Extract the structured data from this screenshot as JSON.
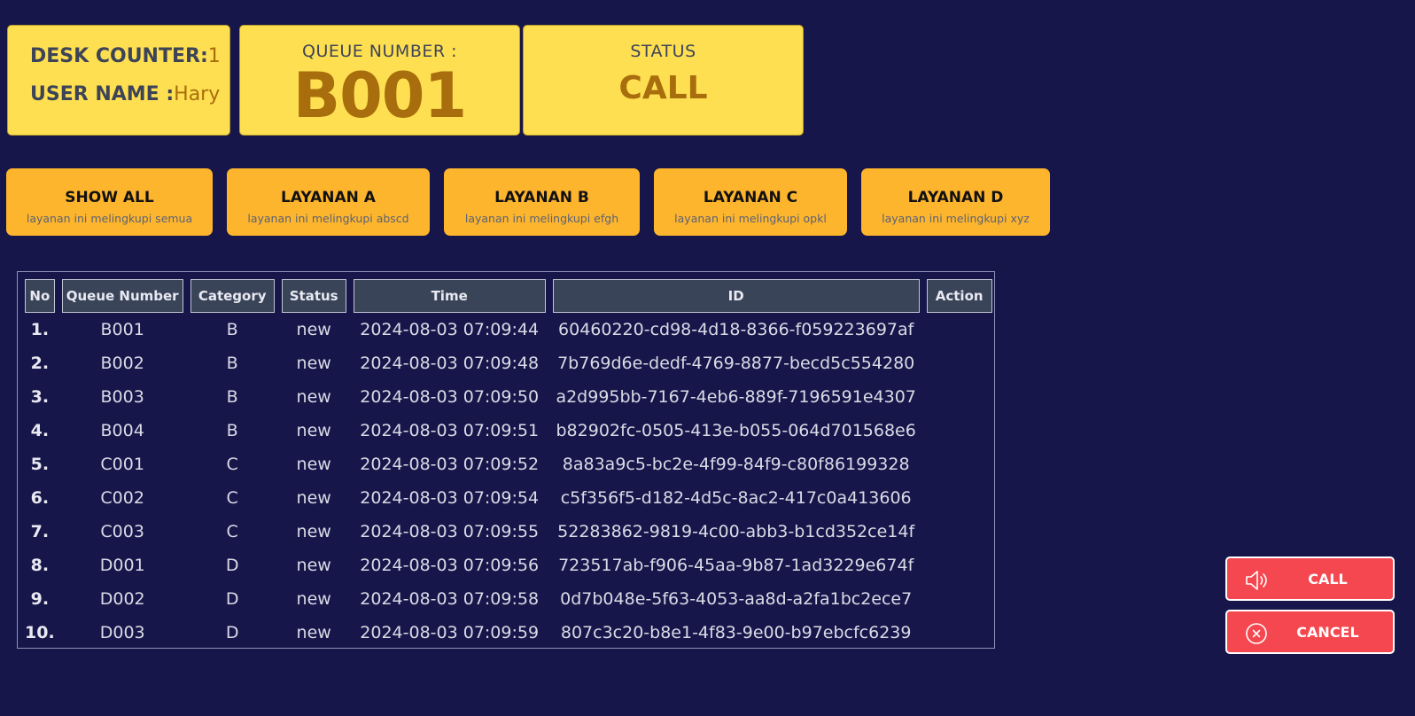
{
  "info": {
    "desk_label": "DESK COUNTER:",
    "desk_value": "1",
    "user_label": "USER NAME :",
    "user_value": "Hary",
    "queue_caption": "QUEUE NUMBER :",
    "queue_value": "B001",
    "status_caption": "STATUS",
    "status_value": "CALL"
  },
  "filters": [
    {
      "title": "SHOW ALL",
      "subtitle": "layanan ini melingkupi semua"
    },
    {
      "title": "LAYANAN A",
      "subtitle": "layanan ini melingkupi abscd"
    },
    {
      "title": "LAYANAN B",
      "subtitle": "layanan ini melingkupi efgh"
    },
    {
      "title": "LAYANAN C",
      "subtitle": "layanan ini melingkupi opkl"
    },
    {
      "title": "LAYANAN D",
      "subtitle": "layanan ini melingkupi xyz"
    }
  ],
  "table": {
    "headers": [
      "No",
      "Queue Number",
      "Category",
      "Status",
      "Time",
      "ID",
      "Action"
    ],
    "rows": [
      {
        "no": "1.",
        "queue": "B001",
        "category": "B",
        "status": "new",
        "time": "2024-08-03 07:09:44",
        "id": "60460220-cd98-4d18-8366-f059223697af"
      },
      {
        "no": "2.",
        "queue": "B002",
        "category": "B",
        "status": "new",
        "time": "2024-08-03 07:09:48",
        "id": "7b769d6e-dedf-4769-8877-becd5c554280"
      },
      {
        "no": "3.",
        "queue": "B003",
        "category": "B",
        "status": "new",
        "time": "2024-08-03 07:09:50",
        "id": "a2d995bb-7167-4eb6-889f-7196591e4307"
      },
      {
        "no": "4.",
        "queue": "B004",
        "category": "B",
        "status": "new",
        "time": "2024-08-03 07:09:51",
        "id": "b82902fc-0505-413e-b055-064d701568e6"
      },
      {
        "no": "5.",
        "queue": "C001",
        "category": "C",
        "status": "new",
        "time": "2024-08-03 07:09:52",
        "id": "8a83a9c5-bc2e-4f99-84f9-c80f86199328"
      },
      {
        "no": "6.",
        "queue": "C002",
        "category": "C",
        "status": "new",
        "time": "2024-08-03 07:09:54",
        "id": "c5f356f5-d182-4d5c-8ac2-417c0a413606"
      },
      {
        "no": "7.",
        "queue": "C003",
        "category": "C",
        "status": "new",
        "time": "2024-08-03 07:09:55",
        "id": "52283862-9819-4c00-abb3-b1cd352ce14f"
      },
      {
        "no": "8.",
        "queue": "D001",
        "category": "D",
        "status": "new",
        "time": "2024-08-03 07:09:56",
        "id": "723517ab-f906-45aa-9b87-1ad3229e674f"
      },
      {
        "no": "9.",
        "queue": "D002",
        "category": "D",
        "status": "new",
        "time": "2024-08-03 07:09:58",
        "id": "0d7b048e-5f63-4053-aa8d-a2fa1bc2ece7"
      },
      {
        "no": "10.",
        "queue": "D003",
        "category": "D",
        "status": "new",
        "time": "2024-08-03 07:09:59",
        "id": "807c3c20-b8e1-4f83-9e00-b97ebcfc6239"
      }
    ]
  },
  "actions": {
    "call_label": "CALL",
    "cancel_label": "CANCEL"
  },
  "colors": {
    "background": "#17164a",
    "card": "#fedf51",
    "accent_text": "#a86d0c",
    "filter_button": "#feb52e",
    "action_button": "#f5474f",
    "table_header": "#3a4458"
  },
  "icons": {
    "call": "speaker-icon",
    "cancel": "close-circle-icon"
  }
}
